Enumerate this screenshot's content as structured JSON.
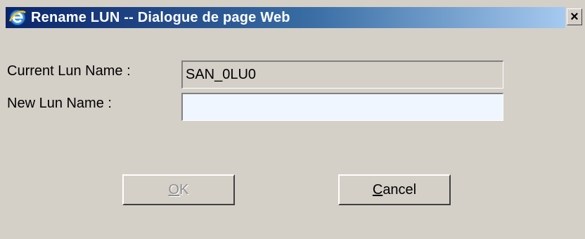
{
  "window": {
    "title": "Rename LUN -- Dialogue de page Web",
    "close_glyph": "×"
  },
  "form": {
    "current_label": "Current Lun Name :",
    "current_value": "SAN_0LU0",
    "new_label": "New Lun Name :",
    "new_value": ""
  },
  "buttons": {
    "ok_label": "OK",
    "ok_disabled": true,
    "cancel_label": "Cancel"
  },
  "icons": {
    "app": "internet-explorer-icon",
    "close": "close-icon"
  }
}
